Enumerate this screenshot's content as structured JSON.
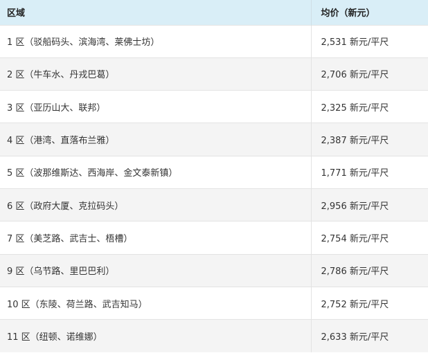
{
  "table": {
    "headers": [
      "区域",
      "均价（新元）"
    ],
    "rows": [
      {
        "district": "1 区（驳船码头、滨海湾、莱佛士坊）",
        "price": "2,531 新元/平尺"
      },
      {
        "district": "2 区（牛车水、丹戎巴葛）",
        "price": "2,706 新元/平尺"
      },
      {
        "district": "3 区（亚历山大、联邦）",
        "price": "2,325 新元/平尺"
      },
      {
        "district": "4 区（港湾、直落布兰雅）",
        "price": "2,387 新元/平尺"
      },
      {
        "district": "5 区（波那维斯达、西海岸、金文泰新镇）",
        "price": "1,771 新元/平尺"
      },
      {
        "district": "6 区（政府大厦、克拉码头）",
        "price": "2,956 新元/平尺"
      },
      {
        "district": "7 区（美芝路、武吉士、梧槽）",
        "price": "2,754 新元/平尺"
      },
      {
        "district": "9 区（乌节路、里巴巴利）",
        "price": "2,786 新元/平尺"
      },
      {
        "district": "10 区（东陵、荷兰路、武吉知马）",
        "price": "2,752 新元/平尺"
      },
      {
        "district": "11 区（纽顿、诺维娜）",
        "price": "2,633 新元/平尺"
      }
    ]
  }
}
